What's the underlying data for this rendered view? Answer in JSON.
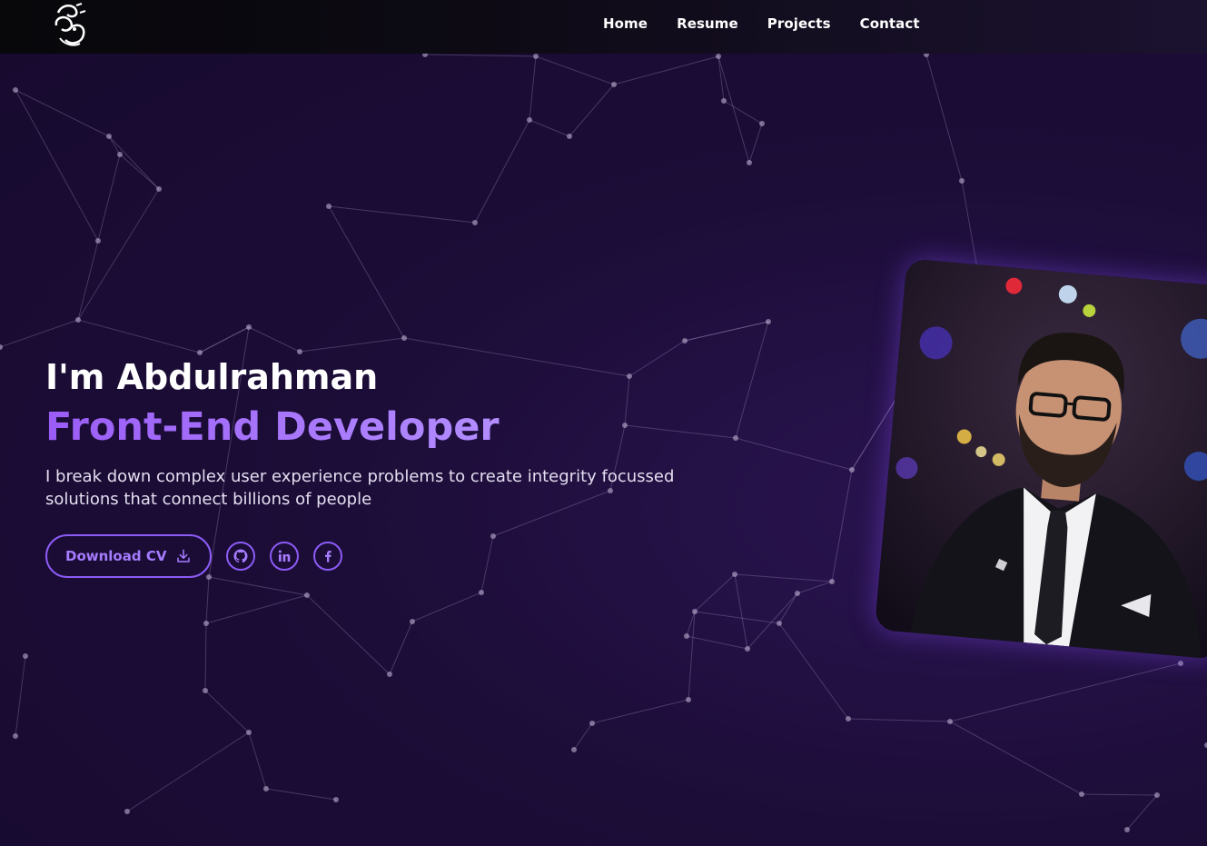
{
  "nav": {
    "logo_alt": "Abdulrahman calligraphy logo",
    "links": [
      "Home",
      "Resume",
      "Projects",
      "Contact"
    ]
  },
  "hero": {
    "greeting": "I'm Abdulrahman",
    "role": "Front-End Developer",
    "description": "I break down complex user experience problems to create integrity focussed solutions that connect billions of people",
    "cv_button": "Download CV"
  },
  "social": [
    "github-icon",
    "linkedin-icon",
    "facebook-icon"
  ],
  "colors": {
    "accent": "#8b5cf6",
    "background": "#1c0d38",
    "nav_bg": "#0a0810"
  }
}
